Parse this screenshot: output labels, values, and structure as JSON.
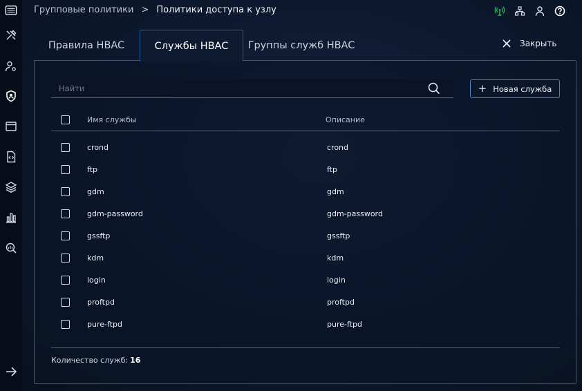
{
  "breadcrumb": {
    "parent": "Групповые политики",
    "current": "Политики доступа к узлу"
  },
  "tabs": [
    {
      "label": "Правила HBAC",
      "active": false
    },
    {
      "label": "Службы HBAC",
      "active": true
    },
    {
      "label": "Группы служб HBAC",
      "active": false
    }
  ],
  "close_label": "Закрыть",
  "search": {
    "placeholder": "Найти",
    "value": ""
  },
  "new_button_label": "Новая служба",
  "table": {
    "columns": [
      "Имя службы",
      "Описание"
    ],
    "rows": [
      {
        "name": "crond",
        "description": "crond"
      },
      {
        "name": "ftp",
        "description": "ftp"
      },
      {
        "name": "gdm",
        "description": "gdm"
      },
      {
        "name": "gdm-password",
        "description": "gdm-password"
      },
      {
        "name": "gssftp",
        "description": "gssftp"
      },
      {
        "name": "kdm",
        "description": "kdm"
      },
      {
        "name": "login",
        "description": "login"
      },
      {
        "name": "proftpd",
        "description": "proftpd"
      },
      {
        "name": "pure-ftpd",
        "description": "pure-ftpd"
      }
    ]
  },
  "footer": {
    "count_label": "Количество служб:",
    "count_value": "16"
  },
  "colors": {
    "accent": "#2a5a9a",
    "status_green": "#2fbf5a",
    "background": "#0d1930"
  },
  "icons": {
    "sidebar": [
      "logo-icon",
      "tools-icon",
      "user-settings-icon",
      "shield-user-icon",
      "window-icon",
      "code-file-icon",
      "layers-icon",
      "bar-chart-icon",
      "search-chart-icon",
      "arrow-right-icon"
    ],
    "topbar": [
      "signal-icon",
      "network-icon",
      "user-icon",
      "help-icon"
    ]
  }
}
